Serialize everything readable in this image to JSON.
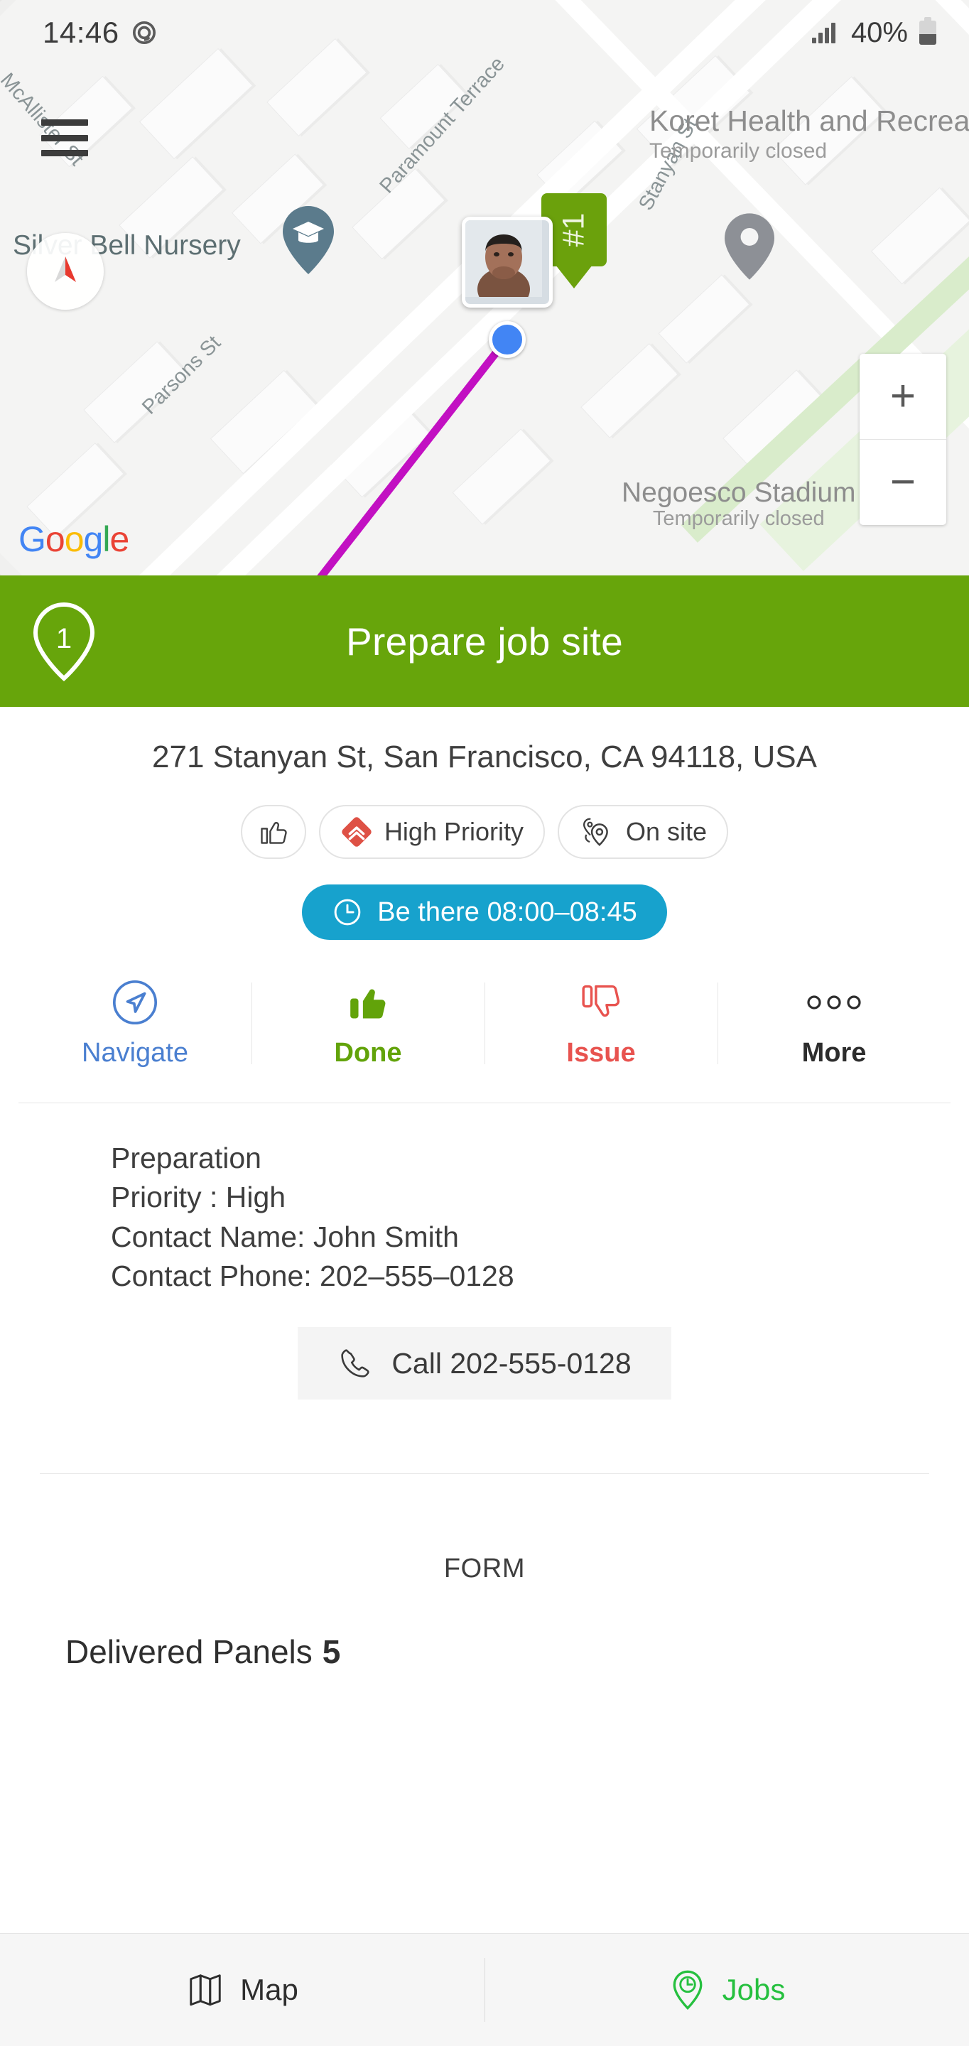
{
  "status_bar": {
    "time": "14:46",
    "recording_icon": "spiral-icon",
    "battery_percent": "40%",
    "signal_icon": "signal-bars-icon",
    "battery_icon": "battery-icon"
  },
  "map": {
    "menu_icon": "hamburger-menu-icon",
    "compass_icon": "compass-icon",
    "attribution": "Google",
    "attribution_letters": [
      "G",
      "o",
      "o",
      "g",
      "l",
      "e"
    ],
    "zoom_in_label": "+",
    "zoom_out_label": "−",
    "marker_label": "#1",
    "street_labels": [
      {
        "name": "McAllister St"
      },
      {
        "name": "Paramount Terrace"
      },
      {
        "name": "Stanyan St"
      },
      {
        "name": "Parsons St"
      }
    ],
    "places": [
      {
        "name": "Silver Bell Nursery",
        "icon": "graduation-cap-pin-icon"
      },
      {
        "name": "Koret Health and Recreation Center",
        "status": "Temporarily closed",
        "icon": "map-pin-icon"
      },
      {
        "name": "Negoesco Stadium",
        "status": "Temporarily closed"
      }
    ],
    "route_color": "#c210c2",
    "user_location_icon": "blue-location-dot"
  },
  "job_header": {
    "stop_number": "1",
    "title": "Prepare job site",
    "color": "#67a50b"
  },
  "job": {
    "address": "271 Stanyan St, San Francisco, CA 94118, USA",
    "chips": [
      {
        "id": "thumbs-up",
        "label": "",
        "icon": "thumbs-up-outline-icon"
      },
      {
        "id": "priority",
        "label": "High Priority",
        "icon": "priority-high-diamond-icon",
        "color": "#de5145"
      },
      {
        "id": "on-site",
        "label": "On site",
        "icon": "on-site-pins-icon"
      }
    ],
    "time_window": {
      "label": "Be there 08:00–08:45",
      "icon": "clock-icon",
      "color": "#17a2cd"
    },
    "actions": [
      {
        "id": "navigate",
        "label": "Navigate",
        "icon": "navigate-arrow-icon",
        "color": "#4a7fd0"
      },
      {
        "id": "done",
        "label": "Done",
        "icon": "thumbs-up-filled-icon",
        "color": "#62a30a"
      },
      {
        "id": "issue",
        "label": "Issue",
        "icon": "thumbs-down-outline-icon",
        "color": "#e8534f"
      },
      {
        "id": "more",
        "label": "More",
        "icon": "three-dots-icon",
        "color": "#2d2d2d"
      }
    ],
    "details": [
      "Preparation",
      "Priority : High",
      "Contact Name: John Smith",
      "Contact Phone: 202–555–0128"
    ],
    "call_button": {
      "label": "Call 202-555-0128",
      "icon": "phone-icon"
    }
  },
  "form": {
    "section_label": "FORM",
    "fields": [
      {
        "label": "Delivered Panels",
        "value": "5"
      }
    ]
  },
  "bottom_nav": {
    "items": [
      {
        "id": "map",
        "label": "Map",
        "icon": "folded-map-icon",
        "active": false
      },
      {
        "id": "jobs",
        "label": "Jobs",
        "icon": "pin-clock-icon",
        "active": true
      }
    ]
  }
}
